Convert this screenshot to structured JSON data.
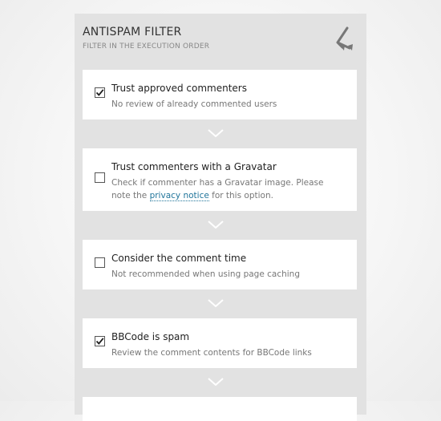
{
  "panel": {
    "title": "ANTISPAM FILTER",
    "subtitle": "FILTER IN THE EXECUTION ORDER",
    "icon": "merge-arrows-icon"
  },
  "filters": [
    {
      "title": "Trust approved commenters",
      "description": "No review of already commented users",
      "checked": true
    },
    {
      "title": "Trust commenters with a Gravatar",
      "description_line1": "Check if commenter has a Gravatar image. Please",
      "description_prefix": "note the ",
      "link_text": "privacy notice",
      "description_suffix": " for this option.",
      "checked": false
    },
    {
      "title": "Consider the comment time",
      "description": "Not recommended when using page caching",
      "checked": false
    },
    {
      "title": "BBCode is spam",
      "description": "Review the comment contents for BBCode links",
      "checked": true
    }
  ],
  "colors": {
    "panel_bg": "#e2e2e2",
    "card_bg": "#ffffff",
    "link": "#21759b",
    "chevron": "#ffffff"
  }
}
